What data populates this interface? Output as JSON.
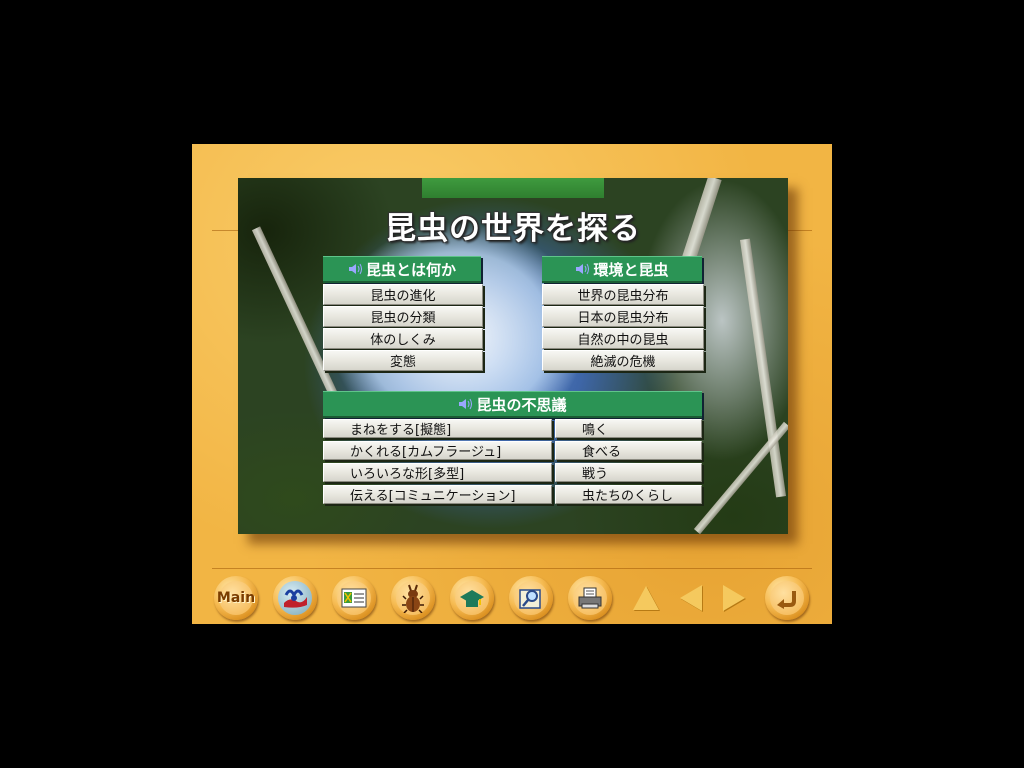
{
  "title": "昆虫の世界を探る",
  "sections": {
    "about": {
      "header": "昆虫とは何か",
      "items": [
        "昆虫の進化",
        "昆虫の分類",
        "体のしくみ",
        "変態"
      ]
    },
    "environment": {
      "header": "環境と昆虫",
      "items": [
        "世界の昆虫分布",
        "日本の昆虫分布",
        "自然の中の昆虫",
        "絶滅の危機"
      ]
    },
    "wonders": {
      "header": "昆虫の不思議",
      "left_items": [
        "まねをする[擬態]",
        "かくれる[カムフラージュ]",
        "いろいろな形[多型]",
        "伝える[コミュニケーション]"
      ],
      "right_items": [
        "鳴く",
        "食べる",
        "戦う",
        "虫たちのくらし"
      ]
    }
  },
  "toolbar": {
    "main_label": "Main",
    "icons": [
      "main-icon",
      "insect-world-icon",
      "card-icon",
      "beetle-icon",
      "school-icon",
      "book-search-icon",
      "printer-icon"
    ],
    "nav": [
      "up-arrow-icon",
      "prev-arrow-icon",
      "next-arrow-icon",
      "return-icon"
    ]
  },
  "colors": {
    "frame": "#f2b544",
    "header_green": "#2b9455",
    "button_face": "#e8e7df",
    "title_text": "#ffffff"
  }
}
